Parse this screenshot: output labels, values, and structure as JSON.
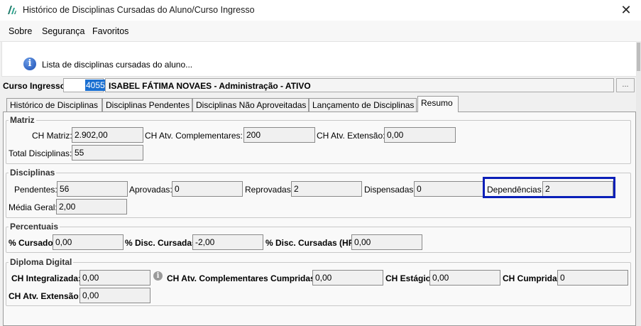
{
  "window": {
    "title": "Histórico de Disciplinas Cursadas do Aluno/Curso Ingresso",
    "close_glyph": "✕"
  },
  "menu": {
    "items": [
      "Sobre",
      "Segurança",
      "Favoritos"
    ]
  },
  "info": {
    "icon": "info-icon",
    "message": "Lista de disciplinas cursadas do aluno..."
  },
  "curso": {
    "label": "Curso Ingresso:",
    "code": "4055",
    "name": "ISABEL FÁTIMA NOVAES - Administração - ATIVO",
    "lookup_button": "..."
  },
  "tabs": [
    {
      "label": "Histórico de Disciplinas"
    },
    {
      "label": "Disciplinas Pendentes"
    },
    {
      "label": "Disciplinas Não Aproveitadas"
    },
    {
      "label": "Lançamento de Disciplinas"
    },
    {
      "label": "Resumo"
    }
  ],
  "matriz": {
    "title": "Matriz",
    "ch_matriz_label": "CH Matriz:",
    "ch_matriz": "2.902,00",
    "ch_atv_comp_label": "CH Atv. Complementares:",
    "ch_atv_comp": "200",
    "ch_atv_ext_label": "CH Atv. Extensão:",
    "ch_atv_ext": "0,00",
    "total_disc_label": "Total Disciplinas:",
    "total_disc": "55"
  },
  "disciplinas": {
    "title": "Disciplinas",
    "pendentes_label": "Pendentes:",
    "pendentes": "56",
    "aprovadas_label": "Aprovadas:",
    "aprovadas": "0",
    "reprovadas_label": "Reprovadas:",
    "reprovadas": "2",
    "dispensadas_label": "Dispensadas:",
    "dispensadas": "0",
    "dependencias_label": "Dependências:",
    "dependencias": "2",
    "media_label": "Média Geral:",
    "media": "2,00"
  },
  "percentuais": {
    "title": "Percentuais",
    "cursado_label": "% Cursado:",
    "cursado": "0,00",
    "disc_cursadas_label": "% Disc. Cursadas:",
    "disc_cursadas": "-2,00",
    "disc_cursadas_hr_label": "% Disc. Cursadas (HR):",
    "disc_cursadas_hr": "0,00"
  },
  "diploma": {
    "title": "Diploma Digital",
    "ch_integralizada_label": "CH Integralizada:",
    "ch_integralizada": "0,00",
    "ch_atv_comp_cumpridas_label": "CH Atv. Complementares Cumpridas:",
    "ch_atv_comp_cumpridas": "0,00",
    "ch_estagio_label": "CH Estágio:",
    "ch_estagio": "0,00",
    "ch_cumprida_label": "CH Cumprida:",
    "ch_cumprida": "0",
    "ch_atv_ext_label": "CH Atv. Extensão:",
    "ch_atv_ext": "0,00"
  }
}
